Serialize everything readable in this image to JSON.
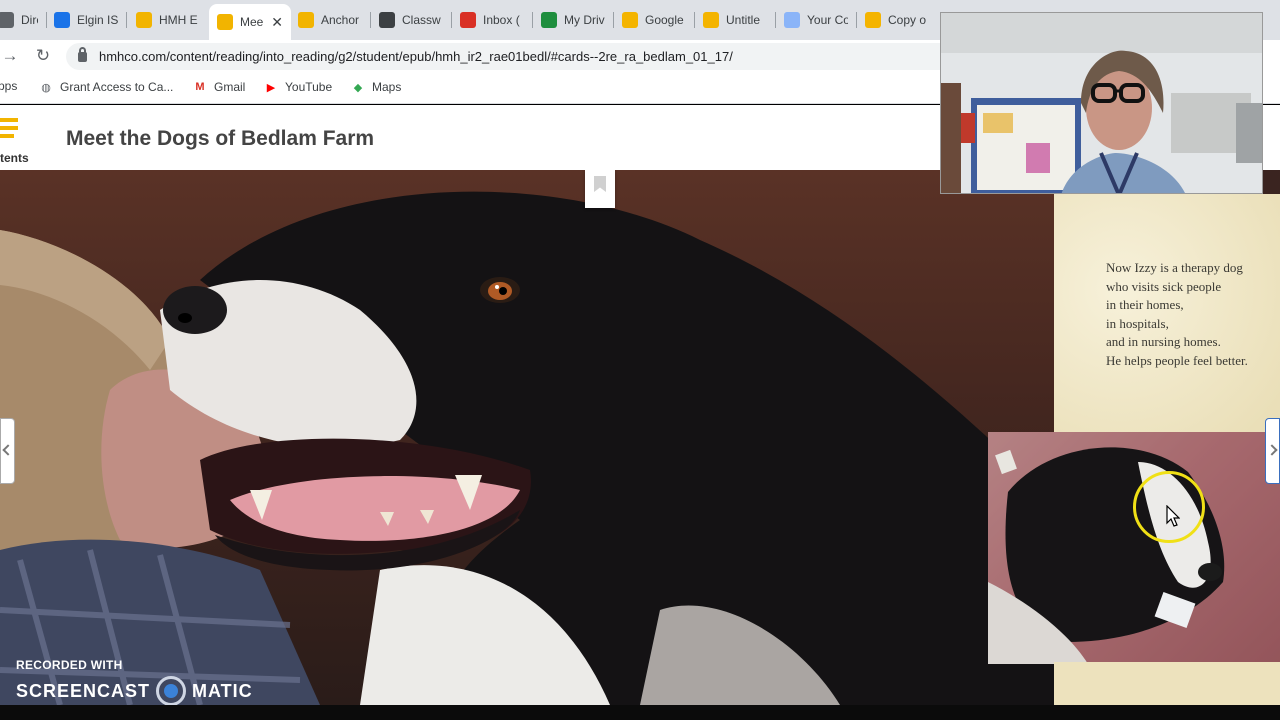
{
  "browser": {
    "tabs": [
      {
        "label": "Directo",
        "favicon": "grid-icon",
        "color": "#5f6368"
      },
      {
        "label": "Elgin IS",
        "favicon": "cloud-icon",
        "color": "#1a73e8"
      },
      {
        "label": "HMH E",
        "favicon": "hmh-shield-icon",
        "color": "#f2b400"
      },
      {
        "label": "Mee",
        "favicon": "hmh-shield-icon",
        "color": "#f2b400",
        "active": true
      },
      {
        "label": "Anchor",
        "favicon": "hmh-shield-icon",
        "color": "#f2b400"
      },
      {
        "label": "Classw",
        "favicon": "classroom-icon",
        "color": "#3c4043"
      },
      {
        "label": "Inbox (",
        "favicon": "gmail-icon",
        "color": "#d93025"
      },
      {
        "label": "My Driv",
        "favicon": "drive-icon",
        "color": "#1e8e3e"
      },
      {
        "label": "Google",
        "favicon": "slides-icon",
        "color": "#f4b400"
      },
      {
        "label": "Untitle",
        "favicon": "slides-icon",
        "color": "#f4b400"
      },
      {
        "label": "Your Co",
        "favicon": "circle-icon",
        "color": "#8ab4f8"
      },
      {
        "label": "Copy o",
        "favicon": "slides-icon",
        "color": "#f4b400"
      }
    ],
    "tab_close_symbol": "✕",
    "url": "hmhco.com/content/reading/into_reading/g2/student/epub/hmh_ir2_rae01bedl/#cards--2re_ra_bedlam_01_17/",
    "bookmarks": [
      {
        "label": "Apps",
        "icon": "apps-icon"
      },
      {
        "label": "Grant Access to Ca...",
        "icon": "globe-icon"
      },
      {
        "label": "Gmail",
        "icon": "gmail-icon"
      },
      {
        "label": "YouTube",
        "icon": "youtube-icon"
      },
      {
        "label": "Maps",
        "icon": "maps-icon"
      }
    ]
  },
  "reader": {
    "contents_label": "tents",
    "book_title": "Meet the Dogs of Bedlam Farm",
    "story_lines": [
      "Now Izzy is a therapy dog",
      "who visits sick people",
      "in their homes,",
      "in hospitals,",
      "and in nursing homes.",
      "He helps people feel better."
    ]
  },
  "watermark": {
    "top": "RECORDED WITH",
    "left": "SCREENCAST",
    "right": "MATIC"
  },
  "colors": {
    "accent": "#f2b400",
    "page_paper": "#f3ecd0"
  }
}
